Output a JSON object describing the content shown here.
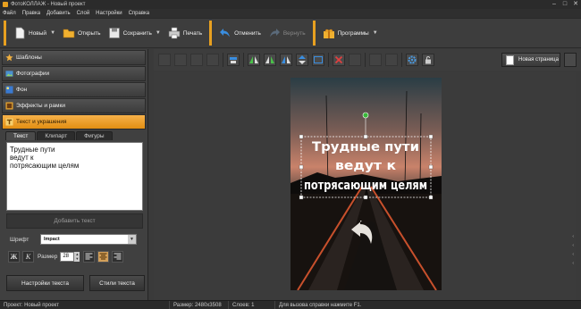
{
  "window": {
    "title": "ФотоКОЛЛАЖ - Новый проект",
    "controls": [
      "–",
      "□",
      "✕"
    ]
  },
  "menu": [
    "Файл",
    "Правка",
    "Добавить",
    "Слой",
    "Настройки",
    "Справка"
  ],
  "toolbar": {
    "new": "Новый",
    "open": "Открыть",
    "save": "Сохранить",
    "print": "Печать",
    "undo": "Отменить",
    "redo": "Вернуть",
    "programs": "Программы"
  },
  "sidebar": {
    "sections": [
      {
        "label": "Шаблоны",
        "icon": "star-icon",
        "color": "#f0b040"
      },
      {
        "label": "Фотографии",
        "icon": "photo-icon",
        "color": "#4a90d0"
      },
      {
        "label": "Фон",
        "icon": "background-icon",
        "color": "#3a7ad0"
      },
      {
        "label": "Эффекты и рамки",
        "icon": "effects-icon",
        "color": "#e0a030"
      },
      {
        "label": "Текст и украшения",
        "icon": "text-icon",
        "color": "#f5d070"
      }
    ]
  },
  "text_panel": {
    "tabs": [
      "Текст",
      "Клипарт",
      "Фигуры"
    ],
    "text_value": "Трудные пути\nведут к\nпотрясающим целям",
    "add_text": "Добавить текст",
    "font_label": "Шрифт",
    "font_value": "Impact",
    "bold": "Ж",
    "italic": "К",
    "size_label": "Размер",
    "size_value": "28",
    "settings_button": "Настройки текста",
    "styles_button": "Стили текста"
  },
  "editbar": {
    "new_page": "Новая страница"
  },
  "canvas": {
    "overlay_text": [
      "Трудные пути",
      "ведут к",
      "потрясающим целям"
    ]
  },
  "status": {
    "project": "Проект:   Новый проект",
    "size": "Размер:   2480x3508",
    "layers": "Слоев:   1",
    "help": "Для вызова справки нажмите F1."
  },
  "colors": {
    "accent": "#e8a020"
  }
}
